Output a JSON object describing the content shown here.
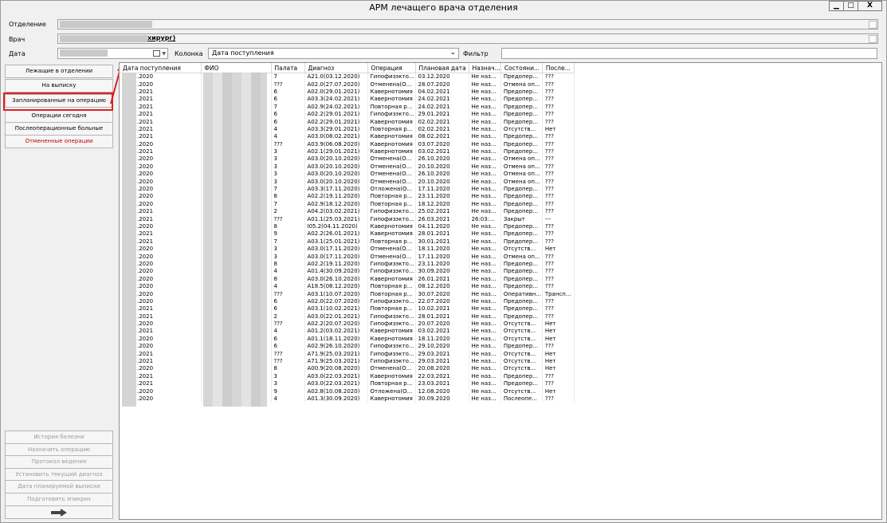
{
  "window": {
    "title": "АРМ лечащего врача отделения",
    "min": "▁",
    "max": "□",
    "close": "X"
  },
  "form": {
    "department_label": "Отделение",
    "department_value": "",
    "doctor_label": "Врач",
    "doctor_value": "хирург)",
    "date_label": "Дата",
    "date_value": "",
    "column_label": "Колонка",
    "column_value": "Дата поступления",
    "filter_label": "Фильтр",
    "filter_value": ""
  },
  "nav": [
    "Лежащие в отделении",
    "На выписку",
    "Запланированные на операцию",
    "Операции сегодня",
    "Послеоперационные больные",
    "Отмененные операции"
  ],
  "actions": [
    "История болезни",
    "Назначить операцию",
    "Протокол ведения",
    "Установить текущий диагноз",
    "Дата планируемой выписки",
    "Подготовить эпикриз"
  ],
  "table": {
    "headers": [
      "Дата поступления",
      "ФИО",
      "Палата",
      "Диагноз",
      "Операция",
      "Плановая дата",
      "Назнач...",
      "Состояни...",
      "После..."
    ],
    "rows": [
      [
        ".2020",
        "",
        "7",
        "A21.0(03.12.2020)",
        "Гипофизэкто...",
        "03.12.2020",
        "Не наз...",
        "Предопер...",
        "???"
      ],
      [
        ".2020",
        "",
        "???",
        "A02.0(27.07.2020)",
        "Отменена(О...",
        "28.07.2020",
        "Не наз...",
        "Отмена оп...",
        "???"
      ],
      [
        ".2021",
        "",
        "6",
        "A02.0(29.01.2021)",
        "Кавернотомия",
        "04.02.2021",
        "Не наз...",
        "Предопер...",
        "???"
      ],
      [
        ".2021",
        "",
        "6",
        "A03.3(24.02.2021)",
        "Кавернотомия",
        "24.02.2021",
        "Не наз...",
        "Предопер...",
        "???"
      ],
      [
        ".2021",
        "",
        "7",
        "A02.9(24.02.2021)",
        "Повторная р...",
        "24.02.2021",
        "Не наз...",
        "Предопер...",
        "???"
      ],
      [
        ".2021",
        "",
        "6",
        "A02.2(29.01.2021)",
        "Гипофизэкто...",
        "29.01.2021",
        "Не наз...",
        "Предопер...",
        "???"
      ],
      [
        ".2021",
        "",
        "6",
        "A02.2(29.01.2021)",
        "Кавернотомия",
        "02.02.2021",
        "Не наз...",
        "Предопер...",
        "???"
      ],
      [
        ".2021",
        "",
        "4",
        "A03.3(29.01.2021)",
        "Повторная р...",
        "02.02.2021",
        "Не наз...",
        "Отсутств...",
        "Нет"
      ],
      [
        ".2021",
        "",
        "4",
        "A03.0(08.02.2021)",
        "Кавернотомия",
        "08.02.2021",
        "Не наз...",
        "Предопер...",
        "???"
      ],
      [
        ".2020",
        "",
        "???",
        "A03.9(06.08.2020)",
        "Кавернотомия",
        "03.07.2020",
        "Не наз...",
        "Предопер...",
        "???"
      ],
      [
        ".2021",
        "",
        "3",
        "A02.1(29.01.2021)",
        "Кавернотомия",
        "03.02.2021",
        "Не наз...",
        "Предопер...",
        "???"
      ],
      [
        ".2020",
        "",
        "3",
        "A03.0(20.10.2020)",
        "Отменена(О...",
        "26.10.2020",
        "Не наз...",
        "Отмена оп...",
        "???"
      ],
      [
        ".2020",
        "",
        "3",
        "A03.0(20.10.2020)",
        "Отменена(О...",
        "20.10.2020",
        "Не наз...",
        "Отмена оп...",
        "???"
      ],
      [
        ".2020",
        "",
        "3",
        "A03.0(20.10.2020)",
        "Отменена(О...",
        "26.10.2020",
        "Не наз...",
        "Отмена оп...",
        "???"
      ],
      [
        ".2020",
        "",
        "3",
        "A03.0(20.10.2020)",
        "Отменена(О...",
        "20.10.2020",
        "Не наз...",
        "Отмена оп...",
        "???"
      ],
      [
        ".2020",
        "",
        "7",
        "A03.3(17.11.2020)",
        "Отложена(О...",
        "17.11.2020",
        "Не наз...",
        "Предопер...",
        "???"
      ],
      [
        ".2020",
        "",
        "8",
        "A02.2(19.11.2020)",
        "Повторная р...",
        "23.11.2020",
        "Не наз...",
        "Предопер...",
        "???"
      ],
      [
        ".2020",
        "",
        "7",
        "A02.9(18.12.2020)",
        "Повторная р...",
        "18.12.2020",
        "Не наз...",
        "Предопер...",
        "???"
      ],
      [
        ".2021",
        "",
        "2",
        "A04.2(03.02.2021)",
        "Гипофизэкто...",
        "25.02.2021",
        "Не наз...",
        "Предопер...",
        "???"
      ],
      [
        ".2021",
        "",
        "???",
        "A01.1(25.03.2021)",
        "Гипофизэкто...",
        "26.03.2021",
        "26:03:...",
        "Закрыт",
        "---"
      ],
      [
        ".2020",
        "",
        "8",
        "I05.2(04.11.2020)",
        "Кавернотомия",
        "04.11.2020",
        "Не наз...",
        "Предопер...",
        "???"
      ],
      [
        ".2021",
        "",
        "9",
        "A02.2(26.01.2021)",
        "Кавернотомия",
        "28.01.2021",
        "Не наз...",
        "Предопер...",
        "???"
      ],
      [
        ".2021",
        "",
        "7",
        "A03.1(25.01.2021)",
        "Повторная р...",
        "30.01.2021",
        "Не наз...",
        "Предопер...",
        "???"
      ],
      [
        ".2020",
        "",
        "3",
        "A03.0(17.11.2020)",
        "Отменена(О...",
        "18.11.2020",
        "Не наз...",
        "Отсутств...",
        "Нет"
      ],
      [
        ".2020",
        "",
        "3",
        "A03.0(17.11.2020)",
        "Отменена(О...",
        "17.11.2020",
        "Не наз...",
        "Отмена оп...",
        "???"
      ],
      [
        ".2020",
        "",
        "8",
        "A02.2(19.11.2020)",
        "Гипофизэкто...",
        "23.11.2020",
        "Не наз...",
        "Предопер...",
        "???"
      ],
      [
        ".2020",
        "",
        "4",
        "A01.4(30.09.2020)",
        "Гипофизэкто...",
        "30.09.2020",
        "Не наз...",
        "Предопер...",
        "???"
      ],
      [
        ".2020",
        "",
        "8",
        "A03.0(26.10.2020)",
        "Кавернотомия",
        "26.01.2021",
        "Не наз...",
        "Предопер...",
        "???"
      ],
      [
        ".2020",
        "",
        "4",
        "A18.5(08.12.2020)",
        "Повторная р...",
        "08.12.2020",
        "Не наз...",
        "Предопер...",
        "???"
      ],
      [
        ".2020",
        "",
        "???",
        "A03.1(10.07.2020)",
        "Повторная р...",
        "30.07.2020",
        "Не наз...",
        "Оперативн...",
        "Трансп..."
      ],
      [
        ".2020",
        "",
        "6",
        "A02.0(22.07.2020)",
        "Гипофизэкто...",
        "22.07.2020",
        "Не наз...",
        "Предопер...",
        "???"
      ],
      [
        ".2021",
        "",
        "6",
        "A03.1(10.02.2021)",
        "Повторная р...",
        "10.02.2021",
        "Не наз...",
        "Предопер...",
        "???"
      ],
      [
        ".2021",
        "",
        "2",
        "A03.0(22.01.2021)",
        "Гипофизэкто...",
        "28.01.2021",
        "Не наз...",
        "Предопер...",
        "???"
      ],
      [
        ".2020",
        "",
        "???",
        "A02.2(20.07.2020)",
        "Гипофизэкто...",
        "20.07.2020",
        "Не наз...",
        "Отсутств...",
        "Нет"
      ],
      [
        ".2021",
        "",
        "4",
        "A01.2(03.02.2021)",
        "Кавернотомия",
        "03.02.2021",
        "Не наз...",
        "Отсутств...",
        "Нет"
      ],
      [
        ".2020",
        "",
        "6",
        "A01.1(18.11.2020)",
        "Кавернотомия",
        "18.11.2020",
        "Не наз...",
        "Отсутств...",
        "Нет"
      ],
      [
        ".2020",
        "",
        "6",
        "A02.9(26.10.2020)",
        "Гипофизэкто...",
        "29.10.2020",
        "Не наз...",
        "Предопер...",
        "???"
      ],
      [
        ".2021",
        "",
        "???",
        "A71.9(25.03.2021)",
        "Гипофизэкто...",
        "29.03.2021",
        "Не наз...",
        "Отсутств...",
        "Нет"
      ],
      [
        ".2021",
        "",
        "???",
        "A71.9(25.03.2021)",
        "Гипофизэкто...",
        "29.03.2021",
        "Не наз...",
        "Отсутств...",
        "Нет"
      ],
      [
        ".2020",
        "",
        "8",
        "A00.9(20.08.2020)",
        "Отменена(О...",
        "20.08.2020",
        "Не наз...",
        "Отсутств...",
        "Нет"
      ],
      [
        ".2021",
        "",
        "3",
        "A03.0(22.03.2021)",
        "Кавернотомия",
        "22.03.2021",
        "Не наз...",
        "Предопер...",
        "???"
      ],
      [
        ".2021",
        "",
        "3",
        "A03.0(22.03.2021)",
        "Повторная р...",
        "23.03.2021",
        "Не наз...",
        "Предопер...",
        "???"
      ],
      [
        ".2020",
        "",
        "9",
        "A02.8(10.08.2020)",
        "Отложена(О...",
        "12.08.2020",
        "Не наз...",
        "Отсутств...",
        "Нет"
      ],
      [
        ".2020",
        "",
        "4",
        "A01.3(30.09.2020)",
        "Кавернотомия",
        "30.09.2020",
        "Не наз...",
        "Послеопе...",
        "???"
      ]
    ]
  },
  "icons": {
    "next": "arrow-right-icon"
  }
}
